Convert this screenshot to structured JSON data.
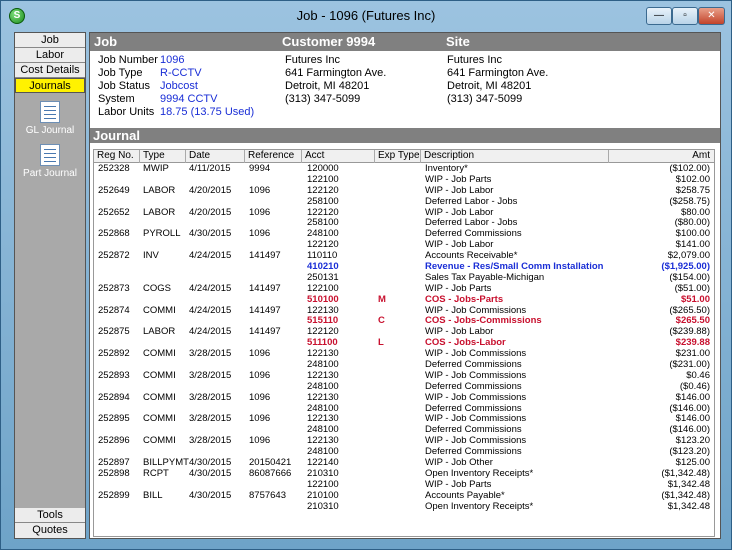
{
  "window": {
    "title": "Job - 1096 (Futures  Inc)",
    "app_icon": "S"
  },
  "sidebar": {
    "items": [
      {
        "label": "Job"
      },
      {
        "label": "Labor"
      },
      {
        "label": "Cost Details"
      },
      {
        "label": "Journals"
      }
    ],
    "subitems": [
      {
        "label": "GL Journal",
        "icon": "gl-journal-icon"
      },
      {
        "label": "Part Journal",
        "icon": "part-journal-icon"
      }
    ],
    "bottom": [
      {
        "label": "Tools"
      },
      {
        "label": "Quotes"
      }
    ]
  },
  "header": {
    "job_title": "Job",
    "customer_title": "Customer 9994",
    "site_title": "Site"
  },
  "job": {
    "fields": [
      {
        "label": "Job Number",
        "value": "1096"
      },
      {
        "label": "Job Type",
        "value": "R-CCTV"
      },
      {
        "label": "Job Status",
        "value": "Jobcost"
      },
      {
        "label": "System",
        "value": "9994 CCTV"
      },
      {
        "label": "Labor Units",
        "value": "18.75 (13.75 Used)"
      }
    ]
  },
  "customer": {
    "lines": [
      "Futures  Inc",
      "641 Farmington Ave.",
      "Detroit, MI  48201",
      "(313) 347-5099"
    ]
  },
  "site": {
    "lines": [
      "Futures  Inc",
      "641 Farmington Ave.",
      "Detroit, MI  48201",
      "(313) 347-5099"
    ]
  },
  "journal": {
    "title": "Journal",
    "columns": [
      "Reg No.",
      "Type",
      "Date",
      "Reference",
      "Acct",
      "Exp Type",
      "Description",
      "Amt"
    ],
    "rows": [
      {
        "reg": "252328",
        "type": "MWIP",
        "date": "4/11/2015",
        "ref": "9994",
        "acct": "120000",
        "exp": "",
        "desc": "Inventory*",
        "amt": "($102.00)",
        "style": ""
      },
      {
        "reg": "",
        "type": "",
        "date": "",
        "ref": "",
        "acct": "122100",
        "exp": "",
        "desc": "WIP - Job Parts",
        "amt": "$102.00",
        "style": ""
      },
      {
        "reg": "252649",
        "type": "LABOR",
        "date": "4/20/2015",
        "ref": "1096",
        "acct": "122120",
        "exp": "",
        "desc": "WIP - Job Labor",
        "amt": "$258.75",
        "style": ""
      },
      {
        "reg": "",
        "type": "",
        "date": "",
        "ref": "",
        "acct": "258100",
        "exp": "",
        "desc": "Deferred Labor - Jobs",
        "amt": "($258.75)",
        "style": ""
      },
      {
        "reg": "252652",
        "type": "LABOR",
        "date": "4/20/2015",
        "ref": "1096",
        "acct": "122120",
        "exp": "",
        "desc": "WIP - Job Labor",
        "amt": "$80.00",
        "style": ""
      },
      {
        "reg": "",
        "type": "",
        "date": "",
        "ref": "",
        "acct": "258100",
        "exp": "",
        "desc": "Deferred Labor - Jobs",
        "amt": "($80.00)",
        "style": ""
      },
      {
        "reg": "252868",
        "type": "PYROLL",
        "date": "4/30/2015",
        "ref": "1096",
        "acct": "248100",
        "exp": "",
        "desc": "Deferred Commissions",
        "amt": "$100.00",
        "style": ""
      },
      {
        "reg": "",
        "type": "",
        "date": "",
        "ref": "",
        "acct": "122120",
        "exp": "",
        "desc": "WIP - Job Labor",
        "amt": "$141.00",
        "style": ""
      },
      {
        "reg": "252872",
        "type": "INV",
        "date": "4/24/2015",
        "ref": "141497",
        "acct": "110110",
        "exp": "",
        "desc": "Accounts Receivable*",
        "amt": "$2,079.00",
        "style": ""
      },
      {
        "reg": "",
        "type": "",
        "date": "",
        "ref": "",
        "acct": "410210",
        "exp": "",
        "desc": "Revenue - Res/Small Comm Installation",
        "amt": "($1,925.00)",
        "style": "blue"
      },
      {
        "reg": "",
        "type": "",
        "date": "",
        "ref": "",
        "acct": "250131",
        "exp": "",
        "desc": "Sales Tax Payable-Michigan",
        "amt": "($154.00)",
        "style": ""
      },
      {
        "reg": "252873",
        "type": "COGS",
        "date": "4/24/2015",
        "ref": "141497",
        "acct": "122100",
        "exp": "",
        "desc": "WIP - Job Parts",
        "amt": "($51.00)",
        "style": ""
      },
      {
        "reg": "",
        "type": "",
        "date": "",
        "ref": "",
        "acct": "510100",
        "exp": "M",
        "desc": "COS - Jobs-Parts",
        "amt": "$51.00",
        "style": "red"
      },
      {
        "reg": "252874",
        "type": "COMMI",
        "date": "4/24/2015",
        "ref": "141497",
        "acct": "122130",
        "exp": "",
        "desc": "WIP - Job Commissions",
        "amt": "($265.50)",
        "style": ""
      },
      {
        "reg": "",
        "type": "",
        "date": "",
        "ref": "",
        "acct": "515110",
        "exp": "C",
        "desc": "COS - Jobs-Commissions",
        "amt": "$265.50",
        "style": "red"
      },
      {
        "reg": "252875",
        "type": "LABOR",
        "date": "4/24/2015",
        "ref": "141497",
        "acct": "122120",
        "exp": "",
        "desc": "WIP - Job Labor",
        "amt": "($239.88)",
        "style": ""
      },
      {
        "reg": "",
        "type": "",
        "date": "",
        "ref": "",
        "acct": "511100",
        "exp": "L",
        "desc": "COS - Jobs-Labor",
        "amt": "$239.88",
        "style": "red"
      },
      {
        "reg": "252892",
        "type": "COMMI",
        "date": "3/28/2015",
        "ref": "1096",
        "acct": "122130",
        "exp": "",
        "desc": "WIP - Job Commissions",
        "amt": "$231.00",
        "style": ""
      },
      {
        "reg": "",
        "type": "",
        "date": "",
        "ref": "",
        "acct": "248100",
        "exp": "",
        "desc": "Deferred Commissions",
        "amt": "($231.00)",
        "style": ""
      },
      {
        "reg": "252893",
        "type": "COMMI",
        "date": "3/28/2015",
        "ref": "1096",
        "acct": "122130",
        "exp": "",
        "desc": "WIP - Job Commissions",
        "amt": "$0.46",
        "style": ""
      },
      {
        "reg": "",
        "type": "",
        "date": "",
        "ref": "",
        "acct": "248100",
        "exp": "",
        "desc": "Deferred Commissions",
        "amt": "($0.46)",
        "style": ""
      },
      {
        "reg": "252894",
        "type": "COMMI",
        "date": "3/28/2015",
        "ref": "1096",
        "acct": "122130",
        "exp": "",
        "desc": "WIP - Job Commissions",
        "amt": "$146.00",
        "style": ""
      },
      {
        "reg": "",
        "type": "",
        "date": "",
        "ref": "",
        "acct": "248100",
        "exp": "",
        "desc": "Deferred Commissions",
        "amt": "($146.00)",
        "style": ""
      },
      {
        "reg": "252895",
        "type": "COMMI",
        "date": "3/28/2015",
        "ref": "1096",
        "acct": "122130",
        "exp": "",
        "desc": "WIP - Job Commissions",
        "amt": "$146.00",
        "style": ""
      },
      {
        "reg": "",
        "type": "",
        "date": "",
        "ref": "",
        "acct": "248100",
        "exp": "",
        "desc": "Deferred Commissions",
        "amt": "($146.00)",
        "style": ""
      },
      {
        "reg": "252896",
        "type": "COMMI",
        "date": "3/28/2015",
        "ref": "1096",
        "acct": "122130",
        "exp": "",
        "desc": "WIP - Job Commissions",
        "amt": "$123.20",
        "style": ""
      },
      {
        "reg": "",
        "type": "",
        "date": "",
        "ref": "",
        "acct": "248100",
        "exp": "",
        "desc": "Deferred Commissions",
        "amt": "($123.20)",
        "style": ""
      },
      {
        "reg": "252897",
        "type": "BILLPYMT",
        "date": "4/30/2015",
        "ref": "20150421",
        "acct": "122140",
        "exp": "",
        "desc": "WIP - Job Other",
        "amt": "$125.00",
        "style": ""
      },
      {
        "reg": "252898",
        "type": "RCPT",
        "date": "4/30/2015",
        "ref": "86087666",
        "acct": "210310",
        "exp": "",
        "desc": "Open Inventory Receipts*",
        "amt": "($1,342.48)",
        "style": ""
      },
      {
        "reg": "",
        "type": "",
        "date": "",
        "ref": "",
        "acct": "122100",
        "exp": "",
        "desc": "WIP - Job Parts",
        "amt": "$1,342.48",
        "style": ""
      },
      {
        "reg": "252899",
        "type": "BILL",
        "date": "4/30/2015",
        "ref": "8757643",
        "acct": "210100",
        "exp": "",
        "desc": "Accounts Payable*",
        "amt": "($1,342.48)",
        "style": ""
      },
      {
        "reg": "",
        "type": "",
        "date": "",
        "ref": "",
        "acct": "210310",
        "exp": "",
        "desc": "Open Inventory Receipts*",
        "amt": "$1,342.48",
        "style": ""
      }
    ]
  }
}
